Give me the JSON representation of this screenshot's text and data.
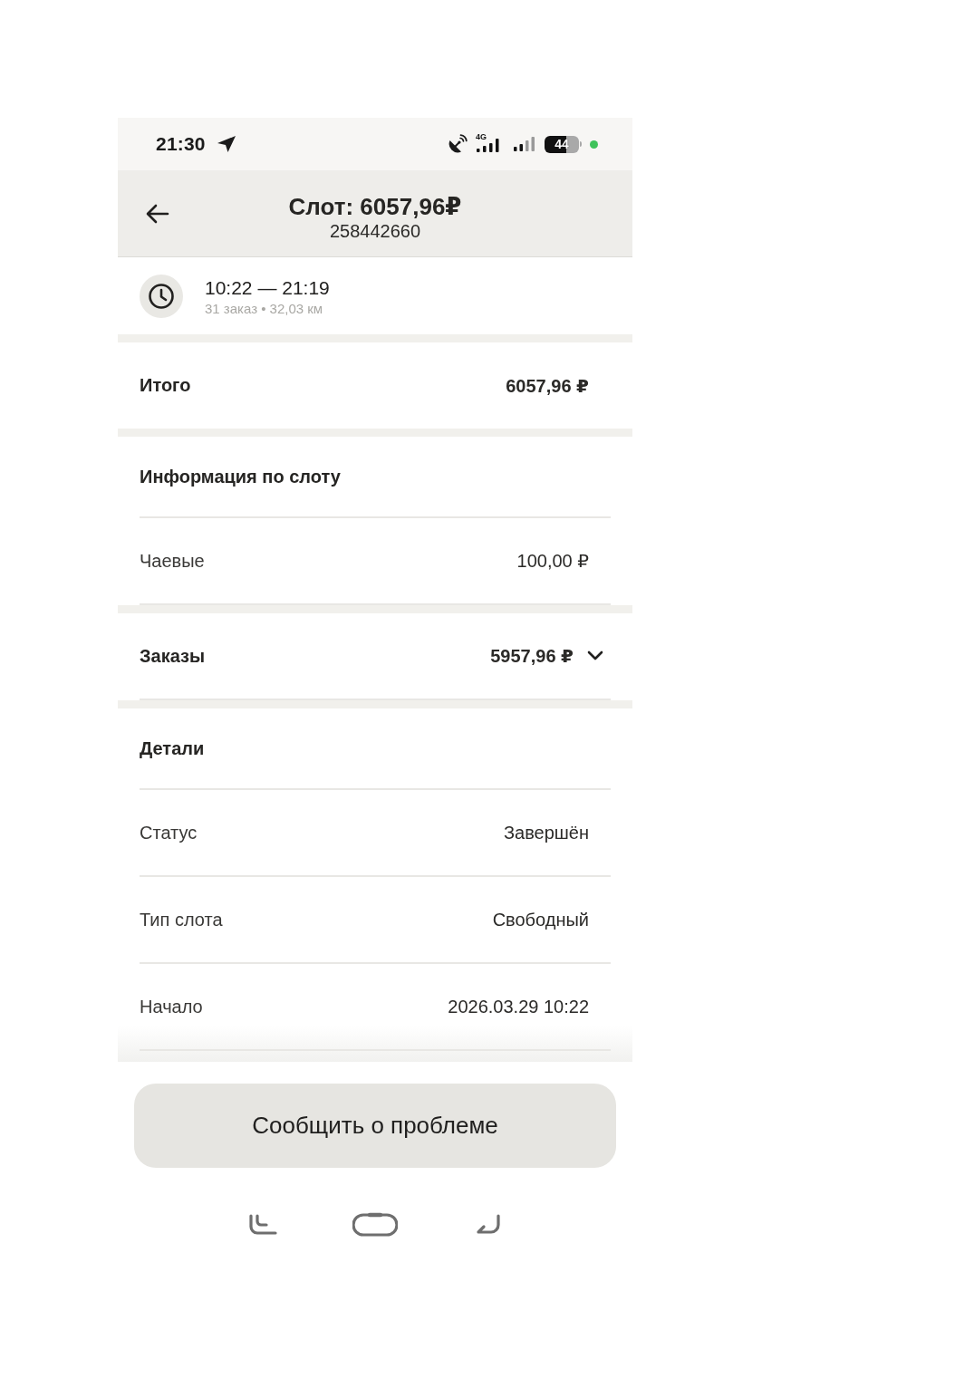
{
  "status_bar": {
    "time": "21:30",
    "network": "4G",
    "battery": "44"
  },
  "header": {
    "title": "Слот: 6057,96₽",
    "subtitle": "258442660"
  },
  "slot_time": {
    "range": "10:22 — 21:19",
    "summary": "31 заказ • 32,03 км"
  },
  "sections": [
    {
      "rows": [
        {
          "kind": "total",
          "label": "Итого",
          "value": "6057,96 ₽"
        }
      ]
    },
    {
      "title": "Информация по слоту",
      "rows": [
        {
          "kind": "item",
          "label": "Чаевые",
          "value": "100,00 ₽"
        }
      ]
    },
    {
      "rows": [
        {
          "kind": "expandable",
          "label": "Заказы",
          "value": "5957,96 ₽",
          "expanded": false
        }
      ]
    },
    {
      "title": "Детали",
      "rows": [
        {
          "kind": "item",
          "label": "Статус",
          "value": "Завершён"
        },
        {
          "kind": "item",
          "label": "Тип слота",
          "value": "Свободный"
        },
        {
          "kind": "item",
          "label": "Начало",
          "value": "2026.03.29 10:22"
        }
      ]
    }
  ],
  "report_button": {
    "label": "Сообщить о проблеме"
  }
}
